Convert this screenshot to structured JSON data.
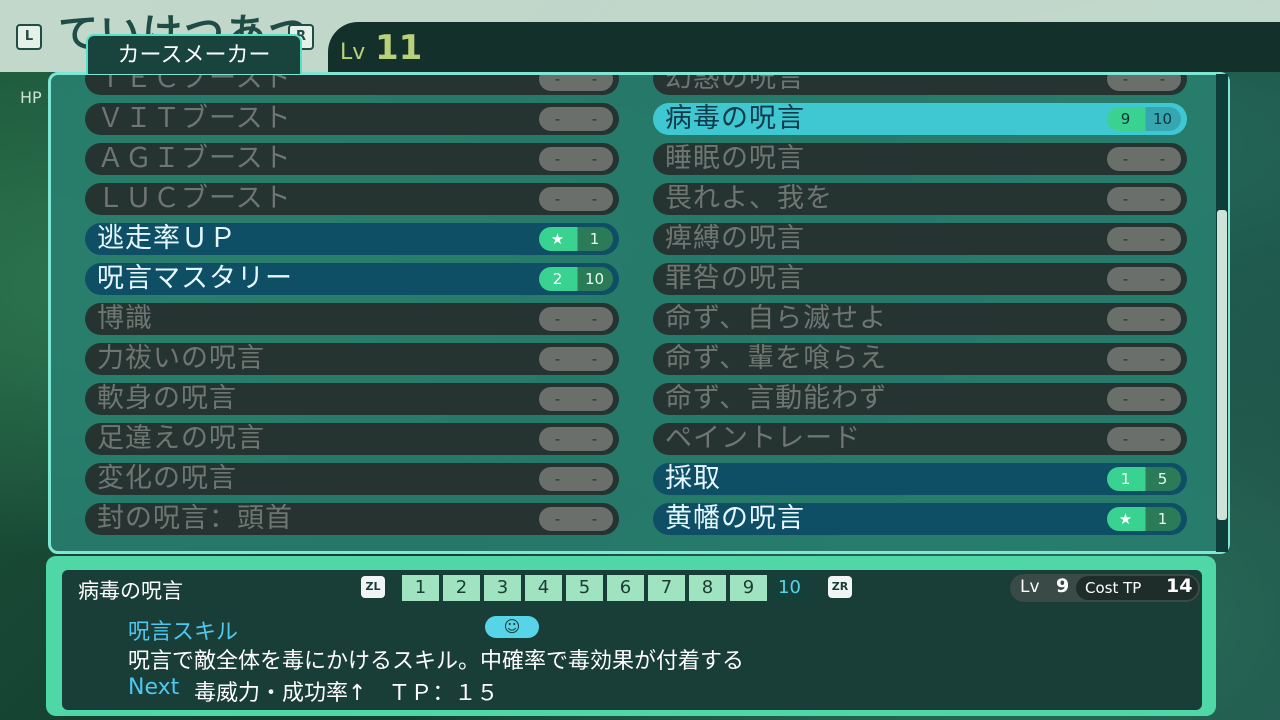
{
  "header": {
    "character_name": "ていけつあつ",
    "left_button": "L",
    "right_button": "R",
    "class_name": "カースメーカー",
    "level_label": "Lv",
    "level_value": "11",
    "hp_label": "HP"
  },
  "left_skills": [
    {
      "name": "ＴＥＣブースト",
      "cur": "-",
      "max": "-",
      "state": "unlearned"
    },
    {
      "name": "ＶＩＴブースト",
      "cur": "-",
      "max": "-",
      "state": "unlearned"
    },
    {
      "name": "ＡＧＩブースト",
      "cur": "-",
      "max": "-",
      "state": "unlearned"
    },
    {
      "name": "ＬＵＣブースト",
      "cur": "-",
      "max": "-",
      "state": "unlearned"
    },
    {
      "name": "逃走率ＵＰ",
      "cur": "★",
      "max": "1",
      "state": "learned"
    },
    {
      "name": "呪言マスタリー",
      "cur": "2",
      "max": "10",
      "state": "learned"
    },
    {
      "name": "博識",
      "cur": "-",
      "max": "-",
      "state": "unlearned"
    },
    {
      "name": "力祓いの呪言",
      "cur": "-",
      "max": "-",
      "state": "unlearned"
    },
    {
      "name": "軟身の呪言",
      "cur": "-",
      "max": "-",
      "state": "unlearned"
    },
    {
      "name": "足違えの呪言",
      "cur": "-",
      "max": "-",
      "state": "unlearned"
    },
    {
      "name": "変化の呪言",
      "cur": "-",
      "max": "-",
      "state": "unlearned"
    },
    {
      "name": "封の呪言：頭首",
      "cur": "-",
      "max": "-",
      "state": "unlearned"
    }
  ],
  "right_skills": [
    {
      "name": "幻惑の呪言",
      "cur": "-",
      "max": "-",
      "state": "unlearned"
    },
    {
      "name": "病毒の呪言",
      "cur": "9",
      "max": "10",
      "state": "selected"
    },
    {
      "name": "睡眠の呪言",
      "cur": "-",
      "max": "-",
      "state": "unlearned"
    },
    {
      "name": "畏れよ、我を",
      "cur": "-",
      "max": "-",
      "state": "unlearned"
    },
    {
      "name": "痺縛の呪言",
      "cur": "-",
      "max": "-",
      "state": "unlearned"
    },
    {
      "name": "罪咎の呪言",
      "cur": "-",
      "max": "-",
      "state": "unlearned"
    },
    {
      "name": "命ず、自ら滅せよ",
      "cur": "-",
      "max": "-",
      "state": "unlearned"
    },
    {
      "name": "命ず、輩を喰らえ",
      "cur": "-",
      "max": "-",
      "state": "unlearned"
    },
    {
      "name": "命ず、言動能わず",
      "cur": "-",
      "max": "-",
      "state": "unlearned"
    },
    {
      "name": "ペイントレード",
      "cur": "-",
      "max": "-",
      "state": "unlearned"
    },
    {
      "name": "採取",
      "cur": "1",
      "max": "5",
      "state": "learned"
    },
    {
      "name": "黄幡の呪言",
      "cur": "★",
      "max": "1",
      "state": "learned"
    }
  ],
  "info": {
    "title": "病毒の呪言",
    "zl": "ZL",
    "zr": "ZR",
    "levels": [
      "1",
      "2",
      "3",
      "4",
      "5",
      "6",
      "7",
      "8",
      "9",
      "10"
    ],
    "active_level": "10",
    "lv_label": "Lv",
    "lv_value": "9",
    "cost_label": "Cost TP",
    "cost_value": "14",
    "skill_type": "呪言スキル",
    "face_icon": "☺",
    "description": "呪言で敵全体を毒にかけるスキル。中確率で毒効果が付着する",
    "next_label": "Next",
    "next_text": "毒威力・成功率↑　ＴＰ：１５"
  },
  "colors": {
    "panel": "#288070",
    "selected": "#40c8d2",
    "learned": "#0e4f66",
    "level_pill_green": "#39d290"
  }
}
